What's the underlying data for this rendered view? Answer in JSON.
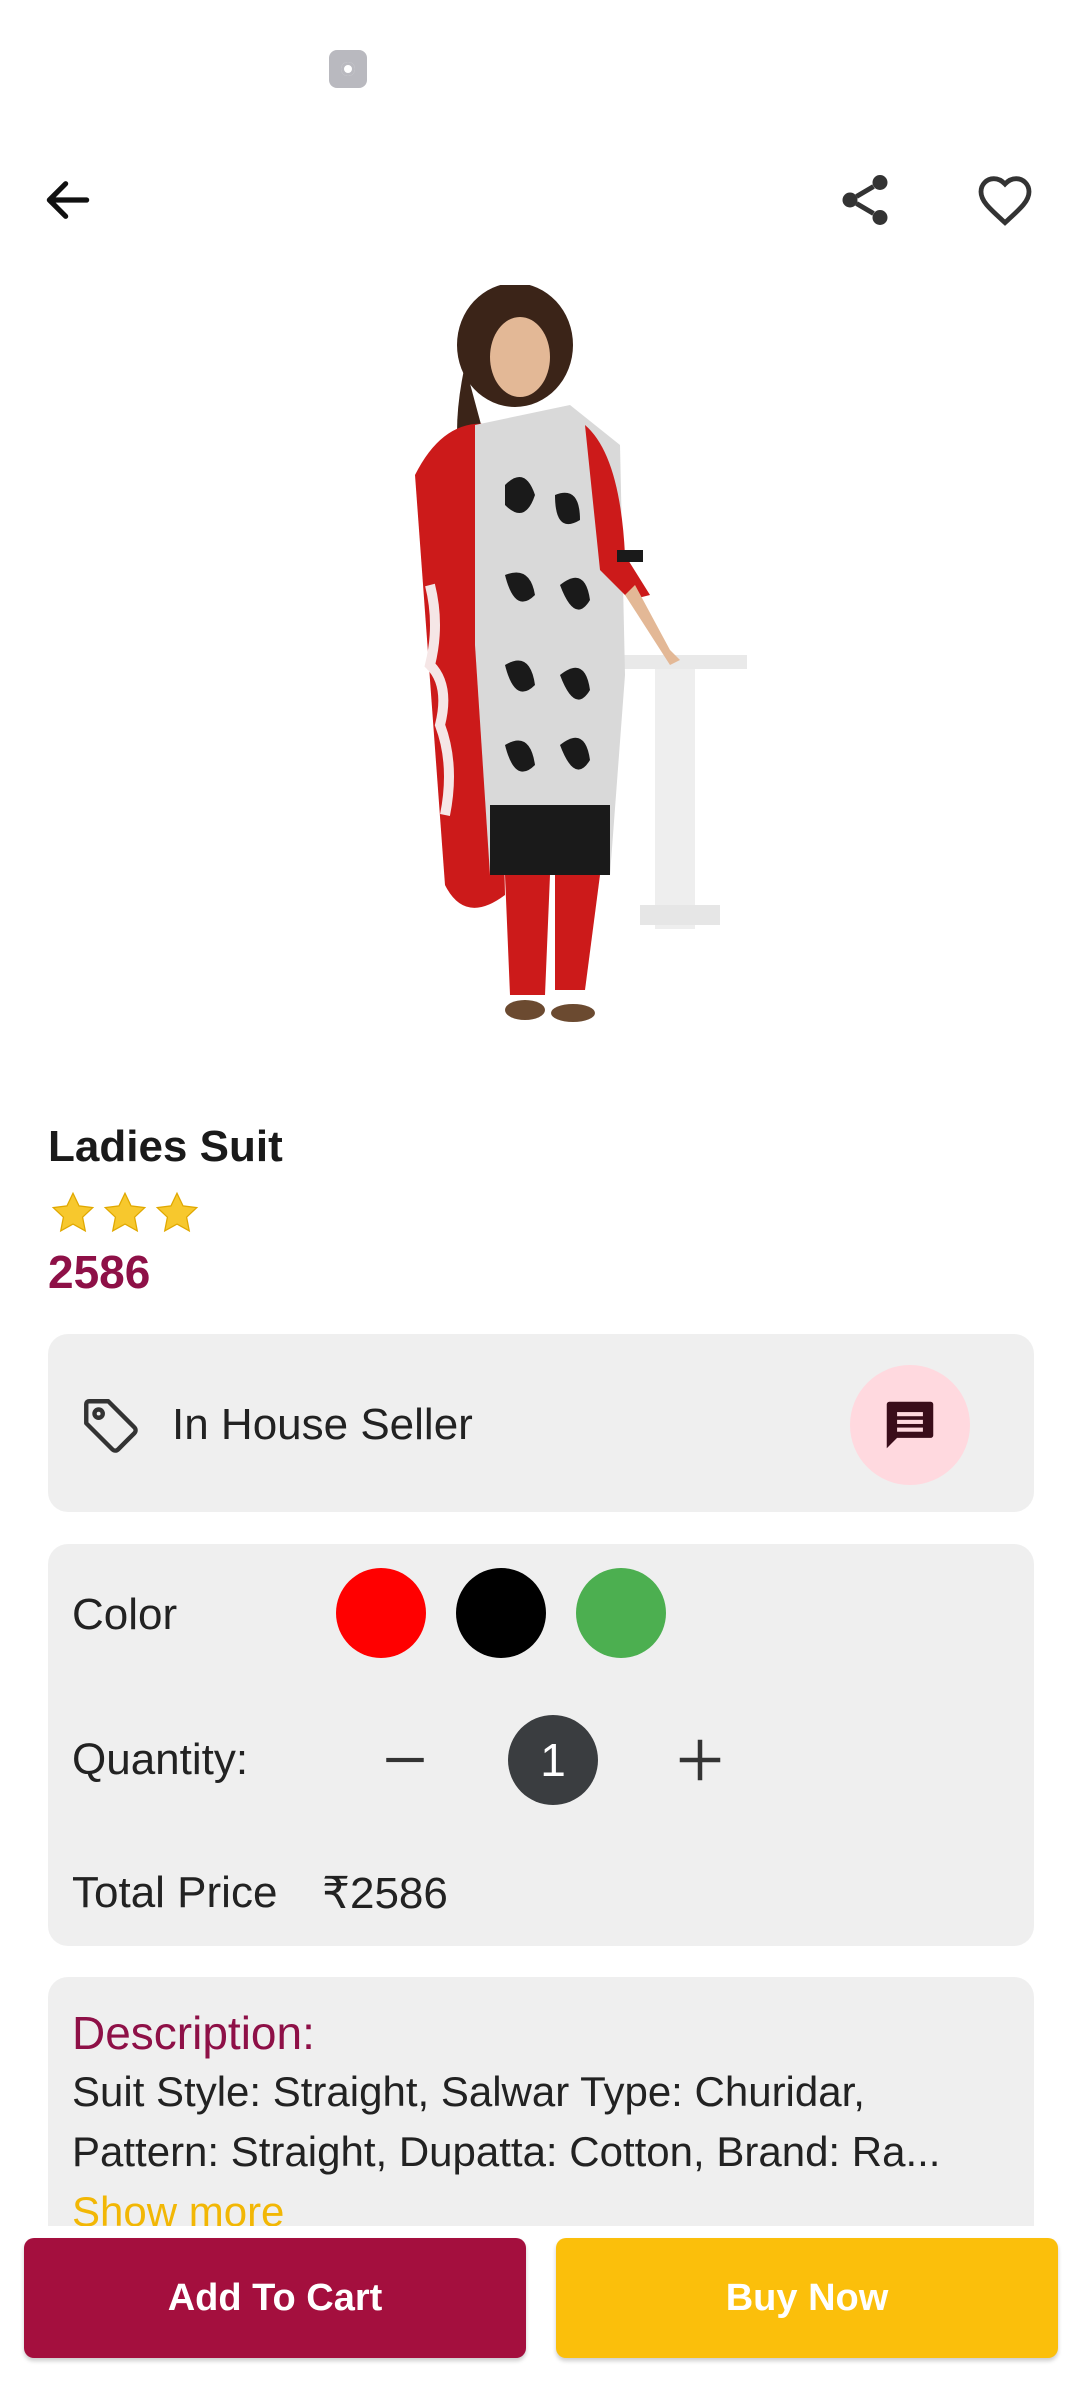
{
  "header": {
    "back_icon": "arrow-left-icon",
    "share_icon": "share-icon",
    "favorite_icon": "heart-outline-icon"
  },
  "product": {
    "title": "Ladies Suit",
    "rating": 3,
    "price": "2586"
  },
  "seller": {
    "label": "In House Seller",
    "tag_icon": "tag-icon",
    "chat_icon": "chat-icon"
  },
  "options": {
    "color_label": "Color",
    "colors": [
      "#ff0000",
      "#000000",
      "#4caf50"
    ],
    "quantity_label": "Quantity:",
    "quantity_value": "1",
    "total_label": "Total Price",
    "total_value": "₹2586"
  },
  "description": {
    "title": "Description:",
    "text": "Suit Style: Straight, Salwar Type: Churidar, Pattern: Straight, Dupatta: Cotton, Brand: Ra... ",
    "show_more": "Show more"
  },
  "actions": {
    "add_to_cart": "Add To Cart",
    "buy_now": "Buy Now"
  },
  "colors": {
    "accent": "#8e1047",
    "cart_button": "#a40f3e",
    "buy_button": "#fbbf0b"
  }
}
